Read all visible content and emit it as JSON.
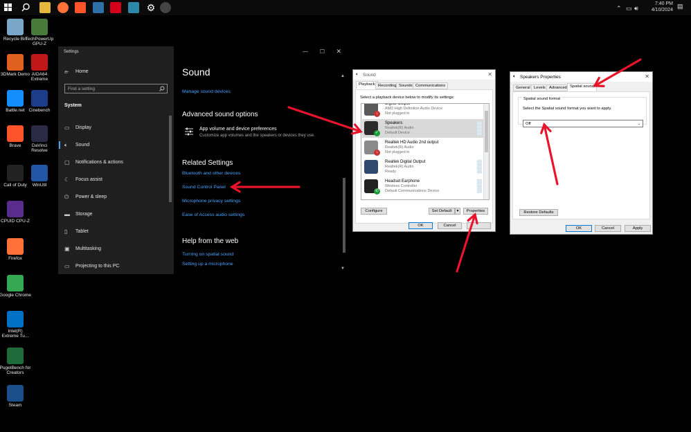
{
  "taskbar": {
    "time": "7:40 PM",
    "date": "4/10/2024",
    "icons": [
      "windows-start",
      "search",
      "file-explorer",
      "firefox",
      "brave",
      "calculator",
      "amd",
      "davinci",
      "settings",
      "app"
    ]
  },
  "desktop": {
    "icons": [
      {
        "label": "Recycle Bin",
        "name": "recycle-bin-icon",
        "color": "#7aa7c7"
      },
      {
        "label": "TechPowerUp GPU-Z",
        "name": "gpu-z-icon",
        "color": "#4a7a3a"
      },
      {
        "label": "3DMark Demo",
        "name": "3dmark-icon",
        "color": "#e06020"
      },
      {
        "label": "AIDA64 Extreme",
        "name": "aida64-icon",
        "color": "#c01818"
      },
      {
        "label": "Battle.net",
        "name": "battle-net-icon",
        "color": "#148eff"
      },
      {
        "label": "Cinebench",
        "name": "cinebench-icon",
        "color": "#1c3e8a"
      },
      {
        "label": "Brave",
        "name": "brave-icon",
        "color": "#fb542b"
      },
      {
        "label": "DaVinci Resolve",
        "name": "davinci-icon",
        "color": "#2a2a44"
      },
      {
        "label": "Call of Duty",
        "name": "call-of-duty-icon",
        "color": "#222222"
      },
      {
        "label": "WinUtil",
        "name": "winutil-icon",
        "color": "#2456a6"
      },
      {
        "label": "CPUID CPU-Z",
        "name": "cpu-z-icon",
        "color": "#5a2d8c"
      },
      {
        "label": "Firefox",
        "name": "firefox-icon",
        "color": "#ff7139"
      },
      {
        "label": "Google Chrome",
        "name": "chrome-icon",
        "color": "#34a853"
      },
      {
        "label": "Intel(R) Extreme Tu...",
        "name": "intel-xtu-icon",
        "color": "#0071c5"
      },
      {
        "label": "PugetBench for Creators",
        "name": "pugetbench-icon",
        "color": "#1f6b3a"
      },
      {
        "label": "Steam",
        "name": "steam-icon",
        "color": "#1b4f8c"
      }
    ]
  },
  "settings": {
    "window_title": "Settings",
    "home": "Home",
    "search_placeholder": "Find a setting",
    "section": "System",
    "nav": [
      "Display",
      "Sound",
      "Notifications & actions",
      "Focus assist",
      "Power & sleep",
      "Storage",
      "Tablet",
      "Multitasking",
      "Projecting to this PC"
    ],
    "page_title": "Sound",
    "manage_link": "Manage sound devices",
    "advanced_heading": "Advanced sound options",
    "app_volume_title": "App volume and device preferences",
    "app_volume_desc": "Customize app volumes and the speakers or devices they use.",
    "related_heading": "Related Settings",
    "related_links": [
      "Bluetooth and other devices",
      "Sound Control Panel",
      "Microphone privacy settings",
      "Ease of Access audio settings"
    ],
    "help_heading": "Help from the web",
    "help_links": [
      "Turning on spatial sound",
      "Setting up a microphone"
    ]
  },
  "sound_dialog": {
    "title": "Sound",
    "tabs": [
      "Playback",
      "Recording",
      "Sounds",
      "Communications"
    ],
    "instruction": "Select a playback device below to modify its settings:",
    "devices": [
      {
        "name": "Digital Output",
        "line1": "AMD High Definition Audio Device",
        "line2": "Not plugged in"
      },
      {
        "name": "Speakers",
        "line1": "Realtek(R) Audio",
        "line2": "Default Device"
      },
      {
        "name": "Realtek HD Audio 2nd output",
        "line1": "Realtek(R) Audio",
        "line2": "Not plugged in"
      },
      {
        "name": "Realtek Digital Output",
        "line1": "Realtek(R) Audio",
        "line2": "Ready"
      },
      {
        "name": "Headset Earphone",
        "line1": "Wireless Controller",
        "line2": "Default Communications Device"
      }
    ],
    "configure": "Configure",
    "set_default": "Set Default",
    "properties": "Properties",
    "ok": "OK",
    "cancel": "Cancel"
  },
  "speaker_dialog": {
    "title": "Speakers Properties",
    "tabs": [
      "General",
      "Levels",
      "Advanced",
      "Spatial sound"
    ],
    "group_label": "Spatial sound format",
    "instruction": "Select the Spatial sound format you want to apply.",
    "selected_format": "Off",
    "restore": "Restore Defaults",
    "ok": "OK",
    "cancel": "Cancel",
    "apply": "Apply"
  },
  "colors": {
    "accent_link": "#4aa3ff",
    "annotation_arrow": "#e8142c",
    "selection": "#cce8ff"
  }
}
